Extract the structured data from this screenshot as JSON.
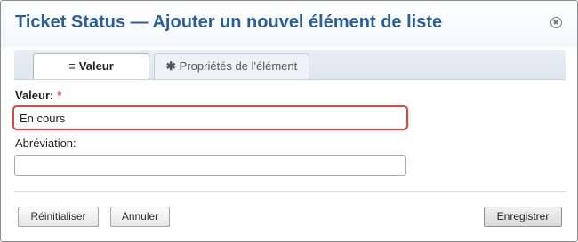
{
  "dialog": {
    "title": "Ticket Status — Ajouter un nouvel élément de liste",
    "close_icon": "close-circle-icon"
  },
  "tabs": [
    {
      "label": "Valeur",
      "icon": "list-icon",
      "glyph": "≡",
      "active": true
    },
    {
      "label": "Propriétés de l'élément",
      "icon": "asterisk-icon",
      "glyph": "✱",
      "active": false
    }
  ],
  "form": {
    "valeur": {
      "label": "Valeur:",
      "required_mark": "*",
      "value": "En cours"
    },
    "abreviation": {
      "label": "Abréviation:",
      "value": ""
    }
  },
  "buttons": {
    "reset": "Réinitialiser",
    "cancel": "Annuler",
    "save": "Enregistrer"
  },
  "colors": {
    "title": "#2c5f97",
    "required": "#d9534f",
    "invalid_border": "#d14b4b"
  }
}
